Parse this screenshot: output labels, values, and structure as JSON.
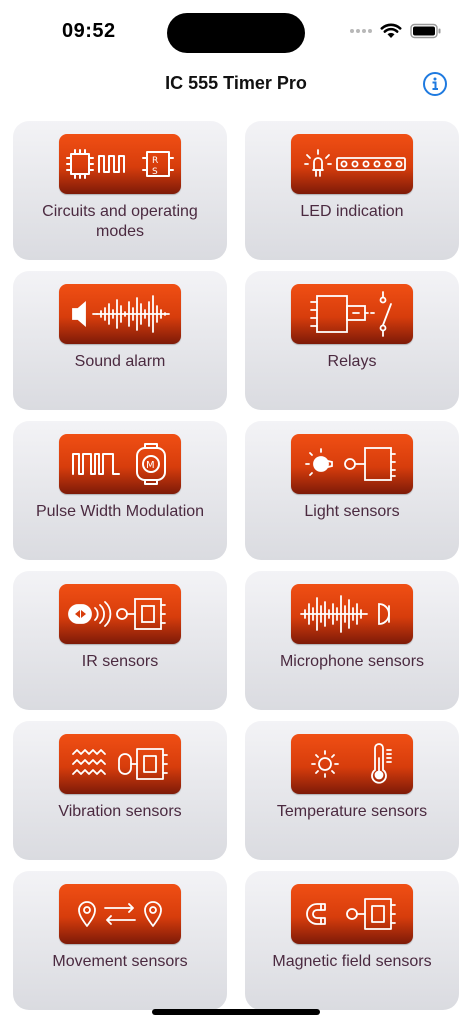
{
  "status": {
    "time": "09:52",
    "icons": [
      "signal-dots-icon",
      "wifi-icon",
      "battery-icon"
    ]
  },
  "header": {
    "title": "IC 555 Timer Pro",
    "info_icon": "info-circle-icon"
  },
  "colors": {
    "accent": "#1e7ae0",
    "tile_icon_top": "#f04f14",
    "tile_icon_bottom": "#7d1a08",
    "label": "#4b2a40"
  },
  "tiles": [
    {
      "label": "Circuits and operating modes",
      "icon": "circuit-modes-icon"
    },
    {
      "label": "LED indication",
      "icon": "led-strip-icon"
    },
    {
      "label": "Sound alarm",
      "icon": "speaker-wave-icon"
    },
    {
      "label": "Relays",
      "icon": "relay-icon"
    },
    {
      "label": "Pulse Width Modulation",
      "icon": "pwm-motor-icon"
    },
    {
      "label": "Light sensors",
      "icon": "light-sensor-icon"
    },
    {
      "label": "IR sensors",
      "icon": "ir-sensor-icon"
    },
    {
      "label": "Microphone sensors",
      "icon": "microphone-sensor-icon"
    },
    {
      "label": "Vibration sensors",
      "icon": "vibration-sensor-icon"
    },
    {
      "label": "Temperature sensors",
      "icon": "temperature-sensor-icon"
    },
    {
      "label": "Movement sensors",
      "icon": "movement-sensor-icon"
    },
    {
      "label": "Magnetic field sensors",
      "icon": "magnetic-sensor-icon"
    }
  ]
}
